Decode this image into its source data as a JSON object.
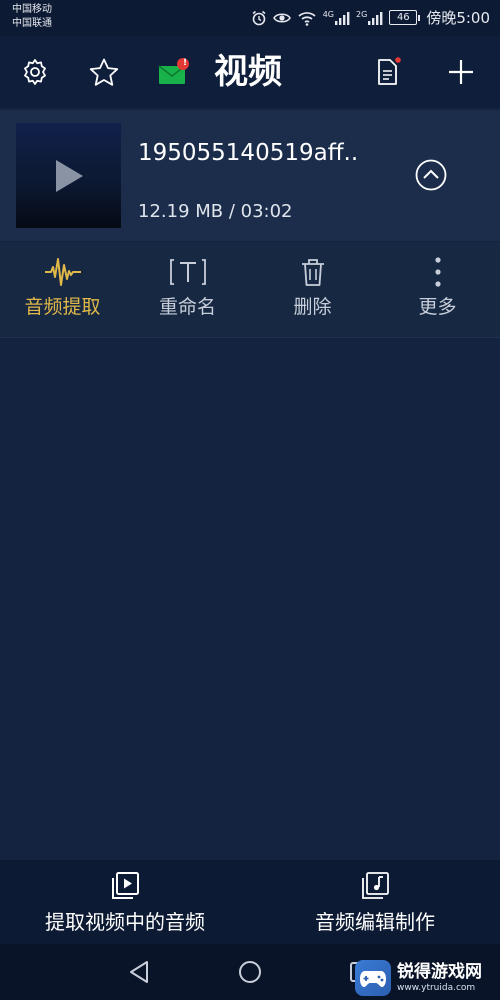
{
  "status": {
    "carrier1": "中国移动",
    "carrier2": "中国联通",
    "net1": "4G",
    "net2": "2G",
    "battery": "46",
    "time": "傍晚5:00"
  },
  "header": {
    "title": "视频",
    "mail_badge": "!"
  },
  "video": {
    "filename": "195055140519aff..",
    "meta": "12.19 MB / 03:02"
  },
  "actions": [
    {
      "label": "音频提取"
    },
    {
      "label": "重命名"
    },
    {
      "label": "删除"
    },
    {
      "label": "更多"
    }
  ],
  "bottom": {
    "extract_label": "提取视频中的音频",
    "edit_label": "音频编辑制作"
  },
  "watermark": {
    "title": "锐得游戏网",
    "url": "www.ytruida.com"
  },
  "colors": {
    "background": "#132340",
    "accent": "#e0b84a",
    "mail": "#19b24a",
    "badge": "#e53935"
  }
}
